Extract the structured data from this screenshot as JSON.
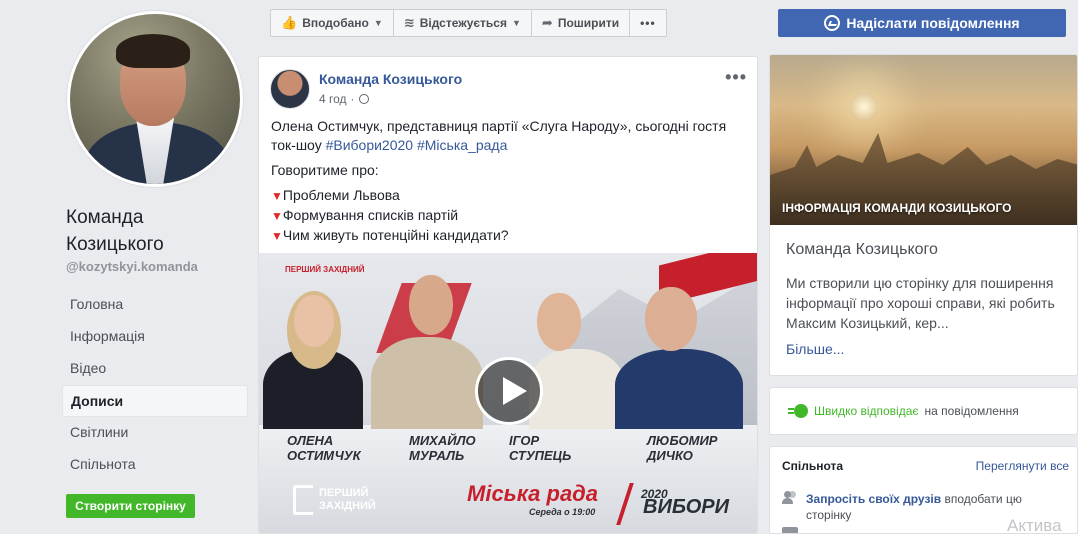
{
  "left": {
    "page_name": "Команда Козицького",
    "handle": "@kozytskyi.komanda",
    "nav": [
      {
        "label": "Головна"
      },
      {
        "label": "Інформація"
      },
      {
        "label": "Відео"
      },
      {
        "label": "Дописи",
        "active": true
      },
      {
        "label": "Світлини"
      },
      {
        "label": "Спільнота"
      }
    ],
    "create_page_label": "Створити сторінку"
  },
  "actions": {
    "liked_label": "Вподобано",
    "following_label": "Відстежується",
    "share_label": "Поширити",
    "more_label": "•••",
    "send_message_label": "Надіслати повідомлення"
  },
  "post": {
    "author": "Команда Козицького",
    "time": "4 год",
    "more": "•••",
    "text_main": "Олена Остимчук, представниця партії «Слуга Народу», сьогодні гостя ток-шоу ",
    "hashtags": [
      "#Вибори2020",
      "#Міська_рада"
    ],
    "intro": "Говоритиме про:",
    "topics": [
      "Проблеми Львова",
      "Формування списків партій",
      "Чим живуть потенційні кандидати?"
    ],
    "video": {
      "channel_top": "ПЕРШИЙ ЗАХІДНИЙ",
      "names": [
        {
          "first": "Олена",
          "last": "Остимчук"
        },
        {
          "first": "Михайло",
          "last": "Мураль"
        },
        {
          "first": "Ігор",
          "last": "Ступець"
        },
        {
          "first": "Любомир",
          "last": "Дичко"
        }
      ],
      "channel_logo_line1": "ПЕРШИЙ",
      "channel_logo_line2": "ЗАХІДНИЙ",
      "show_title": "Міська рада",
      "schedule": "Середа о 19:00",
      "year": "2020",
      "elections": "ВИБОРИ"
    }
  },
  "about": {
    "image_caption": "ІНФОРМАЦІЯ КОМАНДИ КОЗИЦЬКОГО",
    "title": "Команда Козицького",
    "description": "Ми створили цю сторінку для поширення інформації про хороші справи, які робить Максим Козицький, кер...",
    "more_label": "Більше..."
  },
  "reply": {
    "fast": "Швидко відповідає",
    "rest": "на повідомлення"
  },
  "community": {
    "title": "Спільнота",
    "see_all": "Переглянути все",
    "invite_link": "Запросіть своїх друзів",
    "invite_rest": " вподобати цю сторінку"
  },
  "watermark": "Актива"
}
